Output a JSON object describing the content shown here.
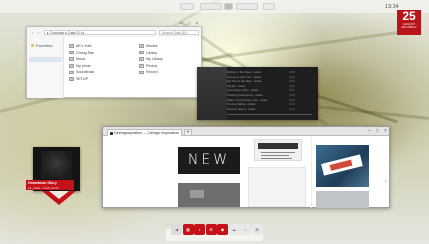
{
  "topbar": {
    "clock": "13:34"
  },
  "calendar": {
    "day": "25",
    "month": "AUGUST",
    "weekday": "SATURDAY"
  },
  "explorer": {
    "path": "▸ Computer ▸ Data (D:) ▸",
    "search_placeholder": "Search Data (D:)",
    "favorites": "Favorites",
    "folders_col1": [
      "AE's Vote",
      "Chung Ran",
      "Music",
      "My photo",
      "Soundtrack",
      "SETUP"
    ],
    "folders_col2": [
      "Movies",
      "Library",
      "My Library",
      "Photos",
      "Record"
    ]
  },
  "player": {
    "tracks": [
      {
        "title": "Rolling in the Deep - Adele",
        "duration": "3:48"
      },
      {
        "title": "Someone Like You - Adele",
        "duration": "4:45"
      },
      {
        "title": "Set Fire to the Rain - Adele",
        "duration": "4:02"
      },
      {
        "title": "Skyfall - Adele",
        "duration": "4:46"
      },
      {
        "title": "Hometown Glory - Adele",
        "duration": "4:31"
      },
      {
        "title": "Chasing Pavements - Adele",
        "duration": "3:30"
      },
      {
        "title": "Make You Feel My Love - Adele",
        "duration": "3:32"
      },
      {
        "title": "Turning Tables - Adele",
        "duration": "4:10"
      },
      {
        "title": "Rumour Has It - Adele",
        "duration": "3:43"
      }
    ]
  },
  "browser": {
    "tab_title": "Deesignspiration — Design Inspiration",
    "new_tab": "+",
    "tile_text": "NEW"
  },
  "album": {
    "title": "Hometown Glory",
    "artist": "19 - Adele - Track 2/4 04"
  },
  "dock": {
    "items": [
      {
        "icon": "back-arrow-icon",
        "color": "#dcdcdc"
      },
      {
        "icon": "calendar-icon",
        "color": "#c41218"
      },
      {
        "icon": "music-icon",
        "color": "#c41218"
      },
      {
        "icon": "settings-icon",
        "color": "#c41218"
      },
      {
        "icon": "chrome-icon",
        "color": "#c41218"
      },
      {
        "icon": "cloud-icon",
        "color": "#e8e8e8"
      },
      {
        "icon": "home-icon",
        "color": "#e8e8e8"
      },
      {
        "icon": "cart-icon",
        "color": "#e8e8e8"
      }
    ]
  }
}
